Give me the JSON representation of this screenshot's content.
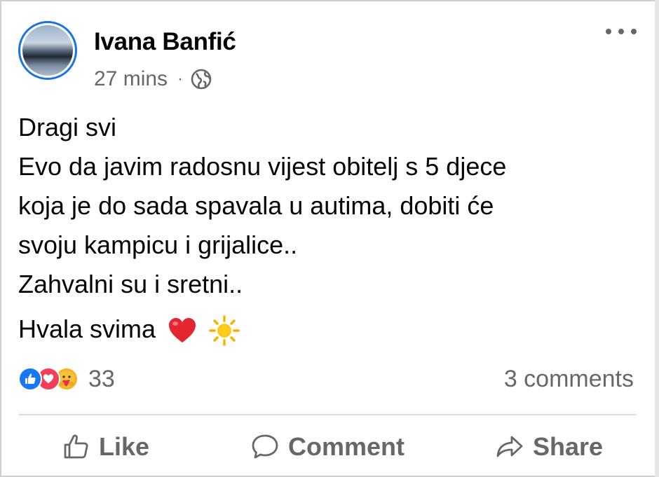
{
  "post": {
    "author": "Ivana Banfić",
    "time": "27 mins",
    "separator": "·",
    "privacy_icon": "globe-icon",
    "menu_icon": "more-options-icon",
    "lines": [
      "Dragi svi",
      "Evo da javim radosnu vijest obitelj s 5 djece",
      "koja je do sada spavala u autima, dobiti će",
      "svoju kampicu i grijalice..",
      "Zahvalni su i sretni.."
    ],
    "closing": "Hvala svima",
    "closing_emojis": [
      "red-heart",
      "sun"
    ]
  },
  "reactions": {
    "icons": [
      "like",
      "love",
      "care"
    ],
    "count": "33",
    "comments": "3 comments"
  },
  "actions": {
    "like": "Like",
    "comment": "Comment",
    "share": "Share"
  },
  "colors": {
    "accent": "#1877f2",
    "love": "#f33e58",
    "care": "#f7b125",
    "secondary_text": "#65676b"
  }
}
